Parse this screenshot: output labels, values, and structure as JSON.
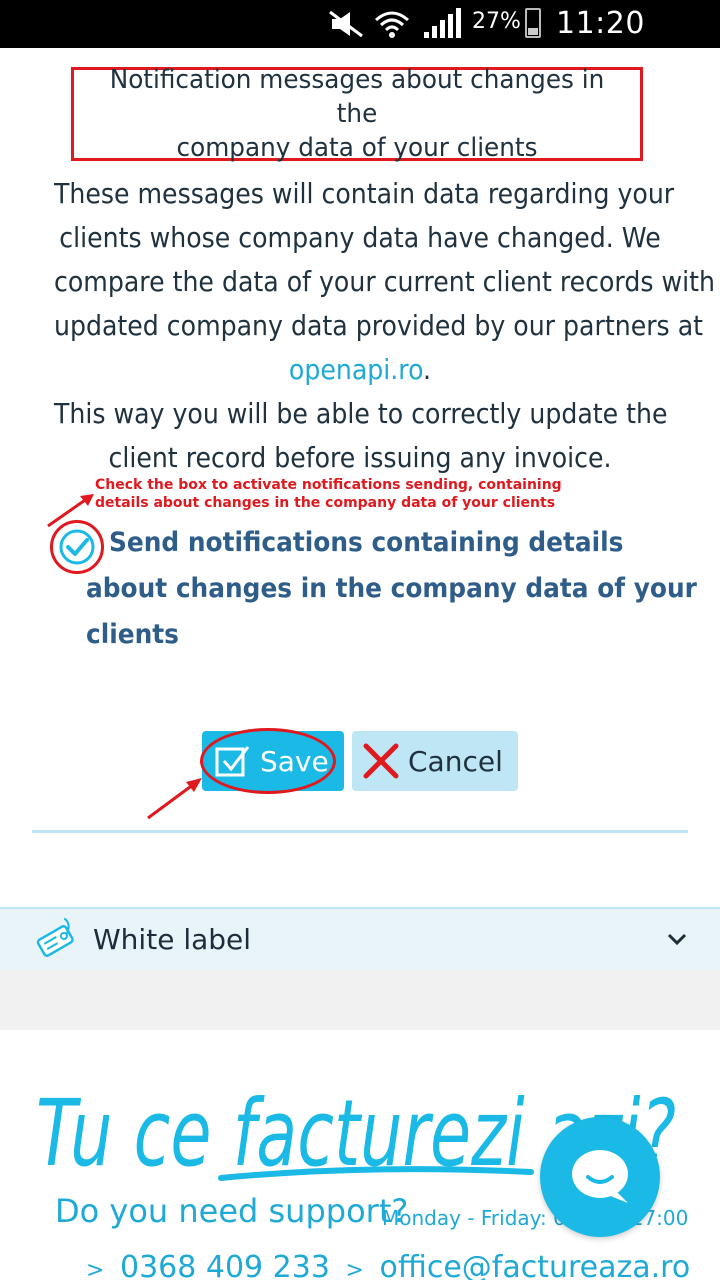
{
  "status_bar": {
    "battery_percent": "27%",
    "time": "11:20 a.m."
  },
  "notification": {
    "title_line1": "Notification messages about changes in the",
    "title_line2": "company data of your clients",
    "desc_line1": "These messages will contain data regarding your",
    "desc_line2": "clients whose company data have changed. We",
    "desc_line3": "compare the data of your current client records with",
    "desc_line4": "updated company data provided by our partners at",
    "desc_link": "openapi.ro",
    "desc_link_suffix": ".",
    "desc_line6": "This way you will be able to correctly update the",
    "desc_line7": "client record before issuing any invoice."
  },
  "annotation": {
    "line1": "Check the box to activate notifications sending, containing",
    "line2": "details about changes in the company data of your clients"
  },
  "checkbox": {
    "checked": true,
    "label_line1": "Send notifications containing details",
    "label_line2": "about changes in the company data of your",
    "label_line3": "clients"
  },
  "buttons": {
    "save_label": "Save",
    "cancel_label": "Cancel"
  },
  "accordion": {
    "white_label": "White label"
  },
  "footer": {
    "slogan": "Tu ce facturezi azi?",
    "support": "Do you need support?",
    "hours": "Monday - Friday: 09:00 - 17:00",
    "phone": "0368 409 233",
    "email": "office@factureaza.ro",
    "bullet": ">"
  },
  "colors": {
    "accent": "#1ab9e6",
    "annotation_red": "#e0191e",
    "text_dark": "#20323f",
    "checkbox_label": "#2f5d8a",
    "cancel_bg": "#bfe6f4"
  }
}
